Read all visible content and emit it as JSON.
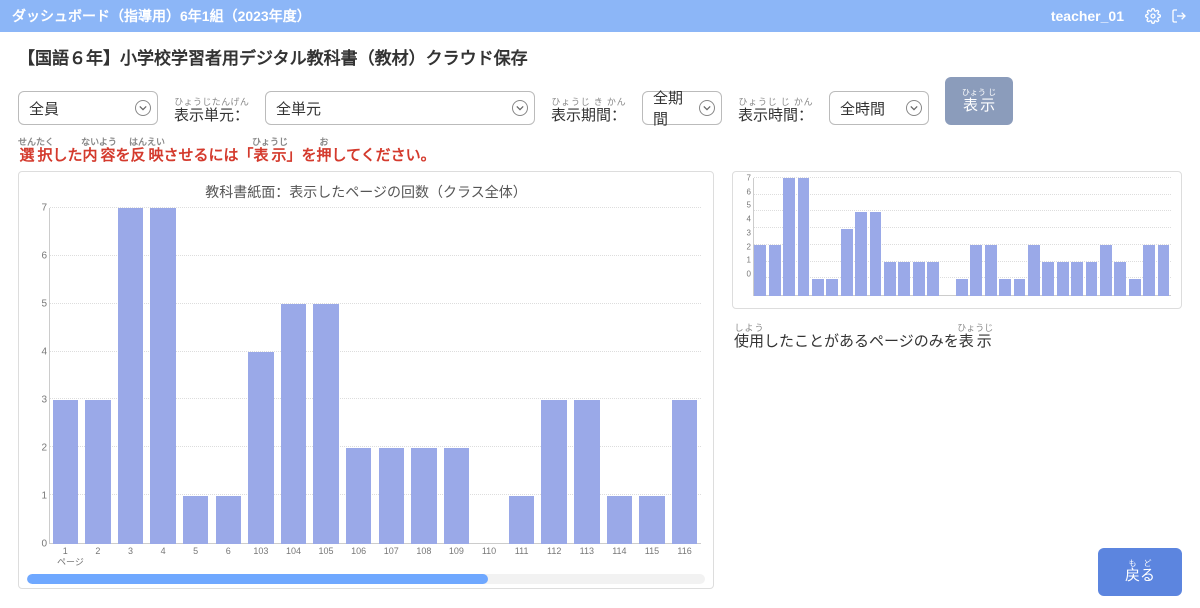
{
  "header": {
    "app_title": "ダッシュボード（指導用）6年1組（2023年度）",
    "user": "teacher_01"
  },
  "page_title": "【国語６年】小学校学習者用デジタル教科書（教材）クラウド保存",
  "filters": {
    "member": {
      "value": "全員"
    },
    "unit_label": "表示単元：",
    "unit_label_ruby": "ひょうじたんげん",
    "unit": {
      "value": "全単元"
    },
    "period_label": "表示期間：",
    "period_label_ruby": "ひょうじ き かん",
    "period": {
      "value": "全期間"
    },
    "time_label": "表示時間：",
    "time_label_ruby": "ひょうじ じ かん",
    "time": {
      "value": "全時間"
    },
    "show_button": "表示",
    "show_button_ruby": "ひょう じ"
  },
  "instruction_html": "<ruby>選択<rt>せんたく</rt></ruby>した<ruby>内容<rt>ないよう</rt></ruby>を<ruby>反映<rt>はんえい</rt></ruby>させるには「<ruby>表示<rt>ひょうじ</rt></ruby>」を<ruby>押<rt>お</rt></ruby>してください。",
  "overview_note_html": "<ruby>使用<rt>しよう</rt></ruby>したことがあるページのみを<ruby>表示<rt>ひょうじ</rt></ruby>",
  "back_label": "戻る",
  "back_label_ruby": "もど",
  "chart_data": {
    "type": "bar",
    "title": "教科書紙面：表示したページの回数（クラス全体）",
    "xlabel": "ページ",
    "ylabel": "",
    "ylim": [
      0,
      7
    ],
    "yticks": [
      0,
      1,
      2,
      3,
      4,
      5,
      6,
      7
    ],
    "categories": [
      "1",
      "2",
      "3",
      "4",
      "5",
      "6",
      "103",
      "104",
      "105",
      "106",
      "107",
      "108",
      "109",
      "110",
      "111",
      "112",
      "113",
      "114",
      "115",
      "116"
    ],
    "values": [
      3,
      3,
      7,
      7,
      1,
      1,
      4,
      5,
      5,
      2,
      2,
      2,
      2,
      0,
      1,
      3,
      3,
      1,
      1,
      3
    ]
  },
  "overview_chart": {
    "type": "bar",
    "ylim": [
      0,
      7
    ],
    "yticks": [
      0,
      1,
      2,
      3,
      4,
      5,
      6,
      7
    ],
    "values": [
      3,
      3,
      7,
      7,
      1,
      1,
      4,
      5,
      5,
      2,
      2,
      2,
      2,
      0,
      1,
      3,
      3,
      1,
      1,
      3,
      2,
      2,
      2,
      2,
      3,
      2,
      1,
      3,
      3
    ]
  }
}
